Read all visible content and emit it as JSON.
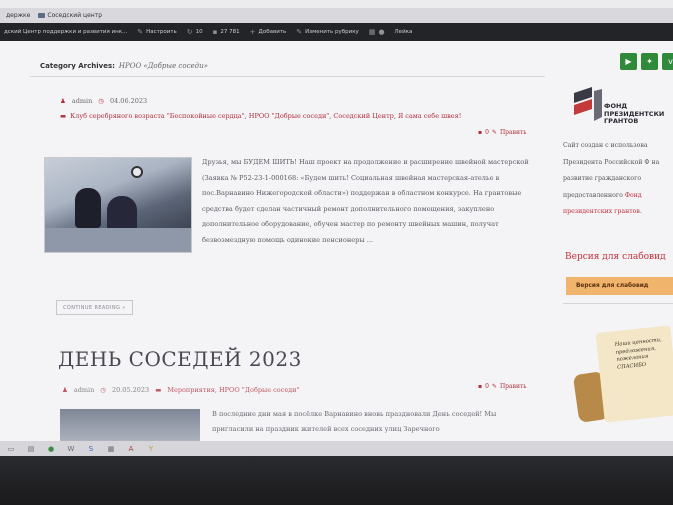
{
  "browser": {
    "tabs": [
      "держке",
      "Соседский центр"
    ]
  },
  "adminbar": {
    "site": "дский Центр поддержки и развития инк...",
    "customize": "Настроить",
    "updates": "10",
    "comments": "27 781",
    "add": "Добавить",
    "edit": "Изменить рубрику",
    "hello": "Лейка"
  },
  "archive": {
    "label": "Category Archives:",
    "name": "НРОО «Добрые соседи»"
  },
  "post1": {
    "author": "admin",
    "date": "04.06.2023",
    "categories": "Клуб серебряного возраста \"Беспокойные сердца\", НРОО \"Добрые соседи\", Соседский Центр, Я сама себе швея!",
    "comment_count": "0",
    "edit_label": "Править",
    "excerpt": "Друзья, мы БУДЕМ ШИТЬ! Наш проект на продолжение и расширение швейной мастерской (Заявка № Р52-23-1-000168: «Будем шить! Социальная швейная мастерская-ателье в пос.Варнавино Нижегородской области») поддержан в областном конкурсе. На грантовые средства будет сделан частичный ремонт дополнительного помещения, закуплено дополнительное оборудование, обучен мастер по ремонту швейных машин, получат безвозмездную помощь одинокие пенсионеры ...",
    "read_more": "CONTINUE READING »"
  },
  "post2": {
    "title": "ДЕНЬ СОСЕДЕЙ 2023",
    "author": "admin",
    "date": "20.05.2023",
    "categories": "Мероприятия, НРОО \"Добрые соседи\"",
    "comment_count": "0",
    "edit_label": "Править",
    "excerpt": "В последние дни мая в посёлке Варнавино вновь праздновали День соседей! Мы пригласили на праздник жителей всех соседних улиц Заречного"
  },
  "sidebar": {
    "fund_name": "ФОНД ПРЕЗИДЕНТСКИ ГРАНТОВ",
    "about_text": "Сайт создан с использова Президента Российской Ф на развитие гражданского предоставленного",
    "about_link1": "Фонд",
    "about_link2": "президентских грантов.",
    "access_heading": "Версия для слабовид",
    "access_button": "Версия для слабовид",
    "scroll_text": "Наши ценности, предложения, пожелания СПАСИБО"
  },
  "colors": {
    "accent": "#b0303a",
    "social_green": "#2f8a3a",
    "button_orange": "#f0b46c"
  }
}
